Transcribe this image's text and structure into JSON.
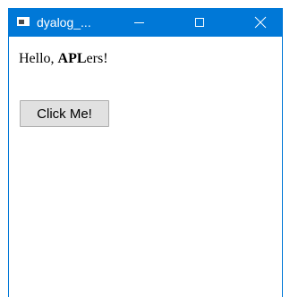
{
  "window": {
    "title": "dyalog_...",
    "app_icon": "window-app-icon",
    "accent_color": "#0078d7",
    "controls": {
      "minimize_icon": "minimize-icon",
      "maximize_icon": "maximize-icon",
      "close_icon": "close-icon"
    }
  },
  "content": {
    "greeting": {
      "prefix": "Hello, ",
      "bold": "APL",
      "suffix": "ers!"
    },
    "button_label": "Click Me!"
  }
}
